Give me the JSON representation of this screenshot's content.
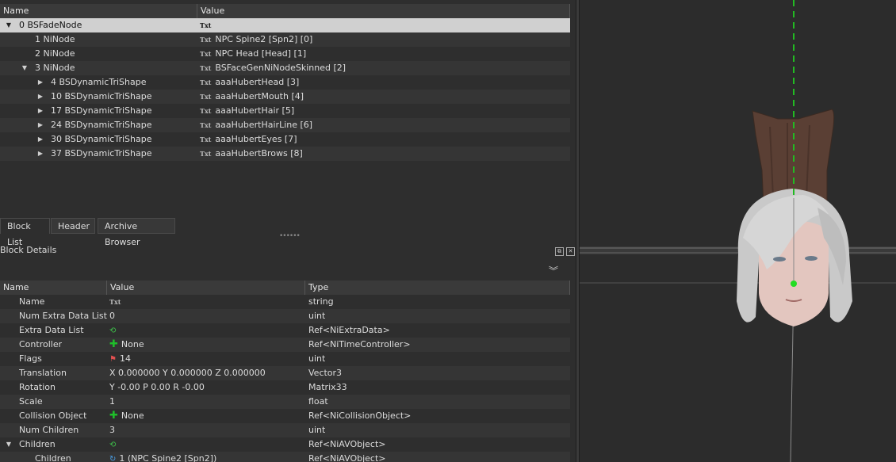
{
  "tree": {
    "columns": [
      "Name",
      "Value"
    ],
    "rows": [
      {
        "name": "0 BSFadeNode",
        "value": "",
        "expander": "down",
        "indent": 0,
        "selected": true
      },
      {
        "name": "1 NiNode",
        "value": "NPC Spine2 [Spn2] [0]",
        "expander": "",
        "indent": 1
      },
      {
        "name": "2 NiNode",
        "value": "NPC Head [Head] [1]",
        "expander": "",
        "indent": 1
      },
      {
        "name": "3 NiNode",
        "value": "BSFaceGenNiNodeSkinned [2]",
        "expander": "down",
        "indent": 1
      },
      {
        "name": "4 BSDynamicTriShape",
        "value": "aaaHubertHead [3]",
        "expander": "right",
        "indent": 2
      },
      {
        "name": "10 BSDynamicTriShape",
        "value": "aaaHubertMouth [4]",
        "expander": "right",
        "indent": 2
      },
      {
        "name": "17 BSDynamicTriShape",
        "value": "aaaHubertHair [5]",
        "expander": "right",
        "indent": 2
      },
      {
        "name": "24 BSDynamicTriShape",
        "value": "aaaHubertHairLine [6]",
        "expander": "right",
        "indent": 2
      },
      {
        "name": "30 BSDynamicTriShape",
        "value": "aaaHubertEyes [7]",
        "expander": "right",
        "indent": 2
      },
      {
        "name": "37 BSDynamicTriShape",
        "value": "aaaHubertBrows [8]",
        "expander": "right",
        "indent": 2
      }
    ],
    "txt_icon": "Txt"
  },
  "tabs": [
    "Block List",
    "Header",
    "Archive Browser"
  ],
  "block_details": {
    "title": "Block Details",
    "columns": [
      "Name",
      "Value",
      "Type"
    ],
    "rows": [
      {
        "name": "Name",
        "value": "",
        "icon": "txt-icon",
        "type": "string"
      },
      {
        "name": "Num Extra Data List",
        "value": "0",
        "icon": "",
        "type": "uint"
      },
      {
        "name": "Extra Data List",
        "value": "",
        "icon": "cycle-icon",
        "type": "Ref<NiExtraData>"
      },
      {
        "name": "Controller",
        "value": "None",
        "icon": "plus-icon",
        "type": "Ref<NiTimeController>"
      },
      {
        "name": "Flags",
        "value": "14",
        "icon": "flag-icon",
        "type": "uint"
      },
      {
        "name": "Translation",
        "value": "X 0.000000 Y 0.000000 Z 0.000000",
        "icon": "",
        "type": "Vector3"
      },
      {
        "name": "Rotation",
        "value": "Y -0.00 P 0.00 R -0.00",
        "icon": "",
        "type": "Matrix33"
      },
      {
        "name": "Scale",
        "value": "1",
        "icon": "",
        "type": "float"
      },
      {
        "name": "Collision Object",
        "value": "None",
        "icon": "plus-icon",
        "type": "Ref<NiCollisionObject>"
      },
      {
        "name": "Num Children",
        "value": "3",
        "icon": "",
        "type": "uint"
      },
      {
        "name": "Children",
        "value": "",
        "icon": "cycle-icon",
        "type": "Ref<NiAVObject>",
        "expander": "down"
      },
      {
        "name": "Children",
        "value": "1 (NPC Spine2 [Spn2])",
        "icon": "link-icon",
        "type": "Ref<NiAVObject>",
        "child": true
      }
    ]
  },
  "colors": {
    "selection": "#d0d0d0",
    "accent_green": "#1fbf2a",
    "axis_green": "#22bb22"
  }
}
